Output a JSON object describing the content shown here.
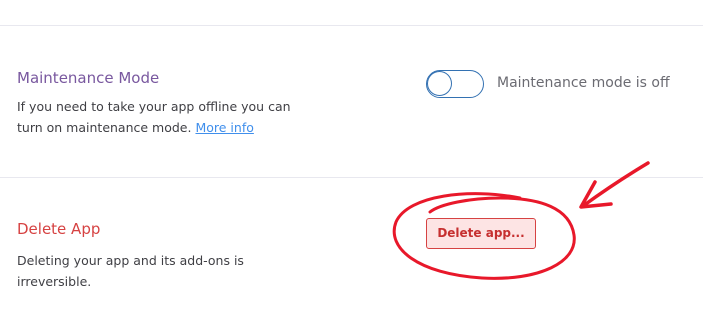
{
  "maintenance": {
    "title": "Maintenance Mode",
    "description": "If you need to take your app offline you can turn on maintenance mode.",
    "link_text": "More info",
    "toggle_on": false,
    "status_text": "Maintenance mode is off"
  },
  "delete_app": {
    "title": "Delete App",
    "description": "Deleting your app and its add-ons is irreversible.",
    "button_label": "Delete app..."
  },
  "colors": {
    "maintenance_title": "#79589f",
    "danger": "#d64242",
    "link": "#408fec",
    "toggle": "#3371b2",
    "annotation": "#e8182a"
  },
  "annotation": {
    "shapes": [
      "hand-drawn-circle",
      "hand-drawn-arrow"
    ],
    "target": "delete-app-button"
  }
}
